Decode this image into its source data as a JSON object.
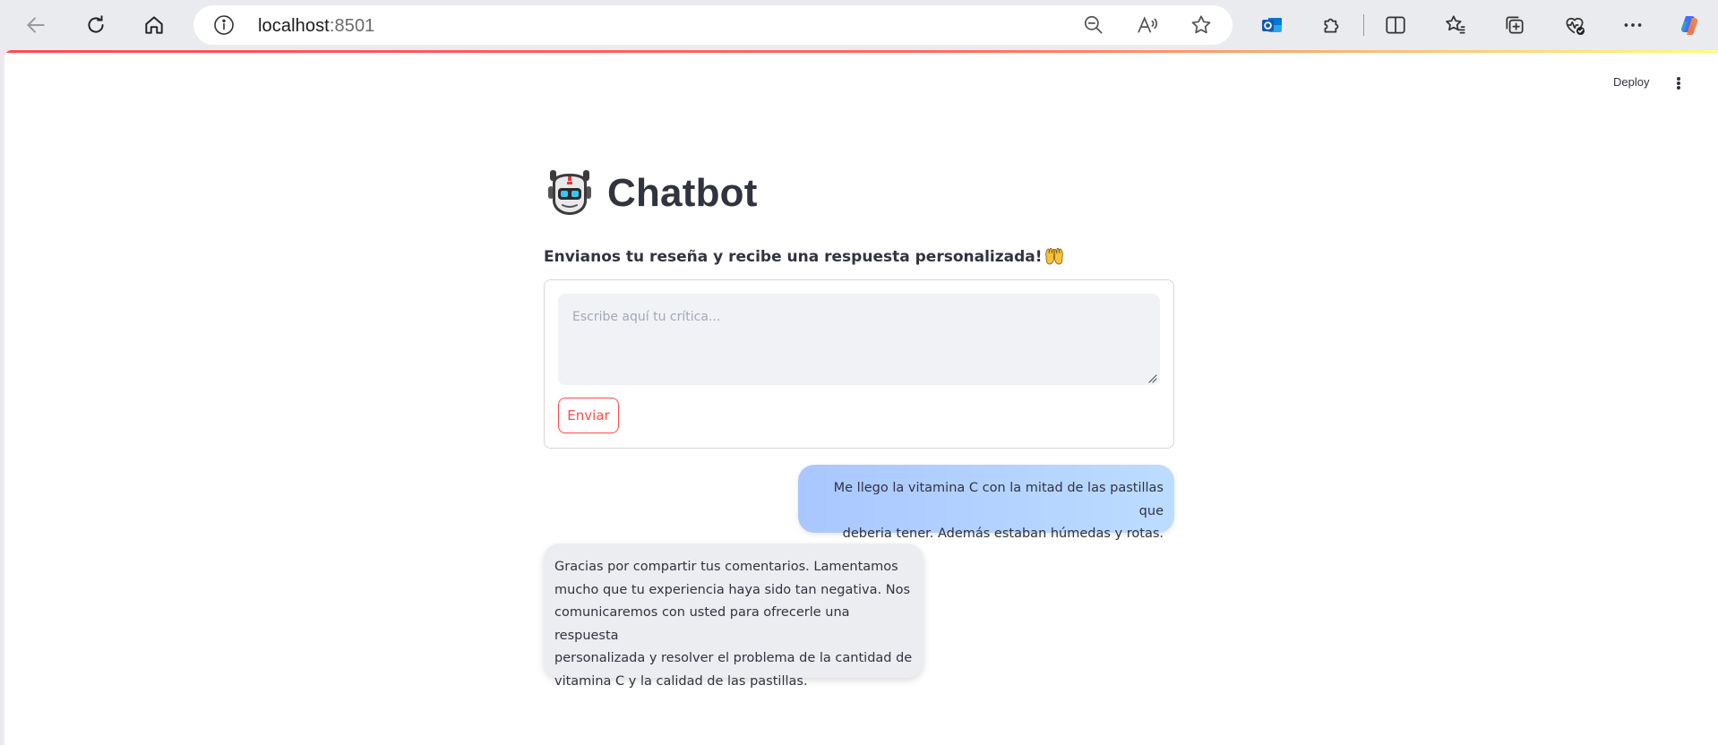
{
  "browser": {
    "url_host": "localhost",
    "url_port": ":8501",
    "icons": {
      "back": "back-arrow-icon",
      "reload": "reload-icon",
      "home": "home-icon",
      "info": "info-icon",
      "zoom": "zoom-out-icon",
      "read_aloud": "read-aloud-icon",
      "favorite": "favorite-star-icon",
      "outlook": "outlook-icon",
      "extensions": "extensions-icon",
      "split": "split-screen-icon",
      "favorites": "favorites-icon",
      "collections": "collections-icon",
      "health": "browser-essentials-icon",
      "more": "more-icon",
      "copilot": "copilot-icon"
    }
  },
  "header": {
    "deploy_label": "Deploy"
  },
  "app": {
    "title": "Chatbot",
    "title_icon": "robot-icon",
    "subtitle": "Envianos tu reseña y recibe una respuesta personalizada!",
    "subtitle_icon": "raising-hands-icon",
    "input_placeholder": "Escribe aquí tu crítica...",
    "input_value": "",
    "submit_label": "Enviar"
  },
  "messages": [
    {
      "role": "user",
      "lines": [
        "Me llego la vitamina C con la mitad de las pastillas que",
        "deberia tener. Además estaban húmedas y rotas."
      ]
    },
    {
      "role": "bot",
      "lines": [
        "Gracias por compartir tus comentarios. Lamentamos",
        "mucho que tu experiencia haya sido tan negativa. Nos",
        "comunicaremos con usted para ofrecerle una respuesta",
        "personalizada y resolver el problema de la cantidad de",
        "vitamina C y la calidad de las pastillas."
      ]
    }
  ],
  "colors": {
    "accent": "#ff4b4b",
    "text": "#31333f",
    "user_bubble_start": "#a9c7ff",
    "user_bubble_end": "#bcdcff",
    "bot_bubble": "#ebedf0"
  }
}
